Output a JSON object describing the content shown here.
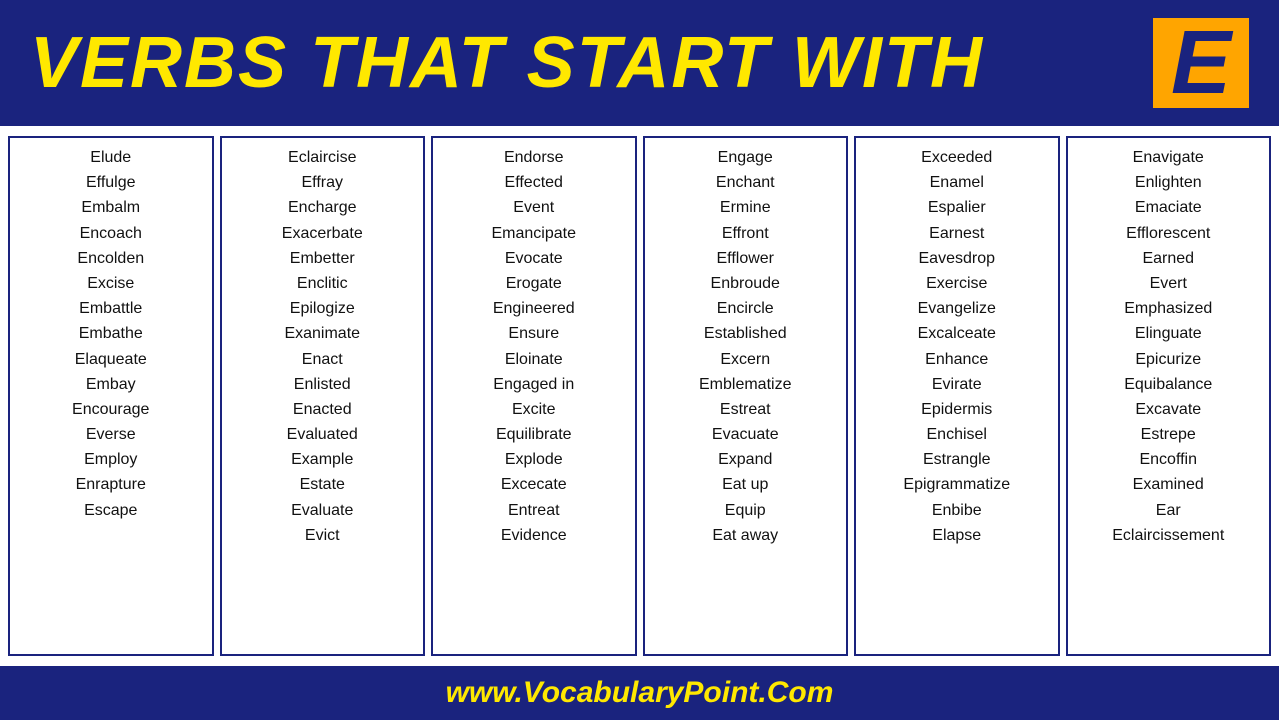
{
  "header": {
    "title": "VERBS THAT START WITH",
    "letter": "E"
  },
  "columns": [
    {
      "id": "col1",
      "words": [
        "Elude",
        "Effulge",
        "Embalm",
        "Encoach",
        "Encolden",
        "Excise",
        "Embattle",
        "Embathe",
        "Elaqueate",
        "Embay",
        "Encourage",
        "Everse",
        "Employ",
        "Enrapture",
        "Escape"
      ]
    },
    {
      "id": "col2",
      "words": [
        "Eclaircise",
        "Effray",
        "Encharge",
        "Exacerbate",
        "Embetter",
        "Enclitic",
        "Epilogize",
        "Exanimate",
        "Enact",
        "Enlisted",
        "Enacted",
        "Evaluated",
        "Example",
        "Estate",
        "Evaluate",
        "Evict"
      ]
    },
    {
      "id": "col3",
      "words": [
        "Endorse",
        "Effected",
        "Event",
        "Emancipate",
        "Evocate",
        "Erogate",
        "Engineered",
        "Ensure",
        "Eloinate",
        "Engaged in",
        "Excite",
        "Equilibrate",
        "Explode",
        "Excecate",
        "Entreat",
        "Evidence"
      ]
    },
    {
      "id": "col4",
      "words": [
        "Engage",
        "Enchant",
        "Ermine",
        "Effront",
        "Efflower",
        "Enbroude",
        "Encircle",
        "Established",
        "Excern",
        "Emblematize",
        "Estreat",
        "Evacuate",
        "Expand",
        "Eat up",
        "Equip",
        "Eat away"
      ]
    },
    {
      "id": "col5",
      "words": [
        "Exceeded",
        "Enamel",
        "Espalier",
        "Earnest",
        "Eavesdrop",
        "Exercise",
        "Evangelize",
        "Excalceate",
        "Enhance",
        "Evirate",
        "Epidermis",
        "Enchisel",
        "Estrangle",
        "Epigrammatize",
        "Enbibe",
        "Elapse"
      ]
    },
    {
      "id": "col6",
      "words": [
        "Enavigate",
        "Enlighten",
        "Emaciate",
        "Efflorescent",
        "Earned",
        "Evert",
        "Emphasized",
        "Elinguate",
        "Epicurize",
        "Equibalance",
        "Excavate",
        "Estrepe",
        "Encoffin",
        "Examined",
        "Ear",
        "Eclaircissement"
      ]
    }
  ],
  "footer": {
    "url": "www.VocabularyPoint.Com"
  }
}
